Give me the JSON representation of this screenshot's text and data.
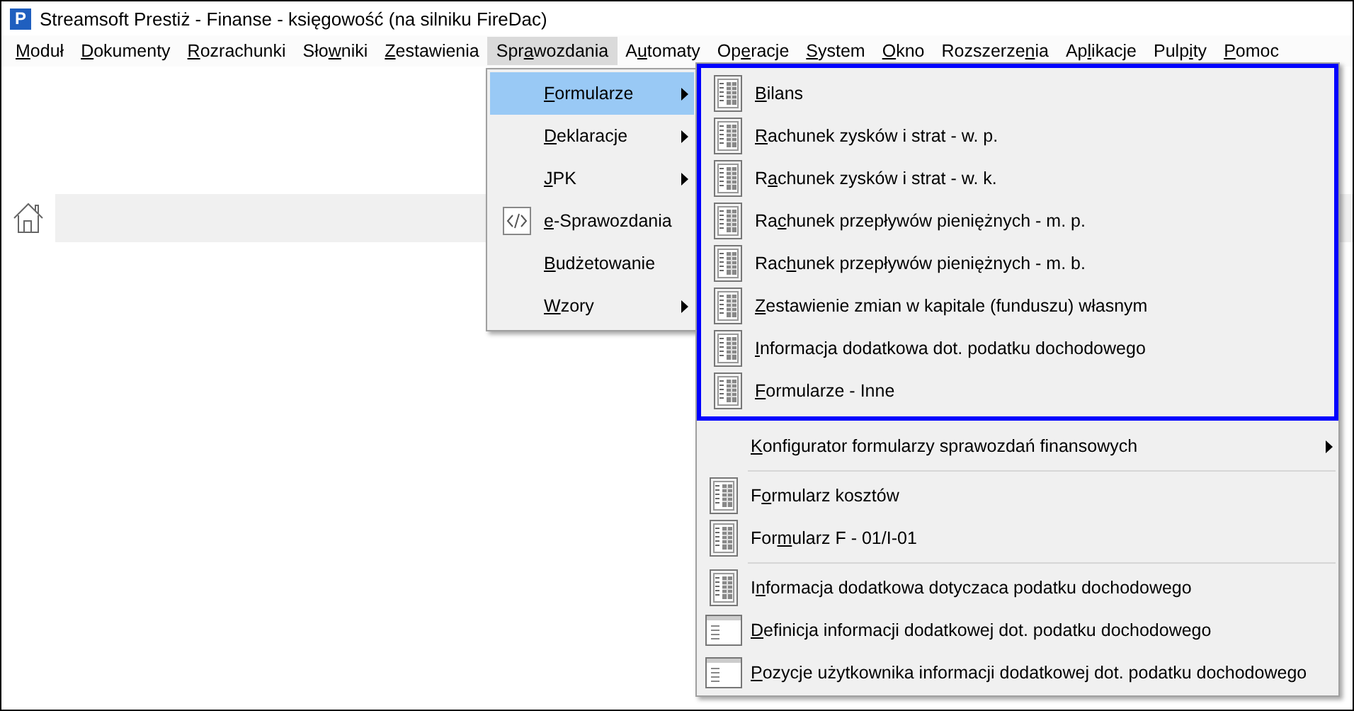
{
  "window": {
    "title": "Streamsoft Prestiż - Finanse - księgowość (na silniku FireDac)",
    "logo": "P"
  },
  "menu_bar": [
    {
      "key": "M",
      "rest": "oduł",
      "selected": false
    },
    {
      "key": "D",
      "rest": "okumenty",
      "selected": false
    },
    {
      "key": "R",
      "rest": "ozrachunki",
      "selected": false
    },
    {
      "lead": "Sło",
      "key": "w",
      "rest": "niki",
      "selected": false
    },
    {
      "key": "Z",
      "rest": "estawienia",
      "selected": false
    },
    {
      "lead": "Spr",
      "key": "a",
      "rest": "wozdania",
      "selected": true
    },
    {
      "lead": "A",
      "key": "u",
      "rest": "tomaty",
      "selected": false
    },
    {
      "lead": "Op",
      "key": "e",
      "rest": "racje",
      "selected": false
    },
    {
      "key": "S",
      "rest": "ystem",
      "selected": false
    },
    {
      "key": "O",
      "rest": "kno",
      "selected": false
    },
    {
      "lead": "Rozszerze",
      "key": "n",
      "rest": "ia",
      "selected": false
    },
    {
      "lead": "Ap",
      "key": "l",
      "rest": "ikacje",
      "selected": false
    },
    {
      "lead": "Pulp",
      "key": "i",
      "rest": "ty",
      "selected": false
    },
    {
      "key": "P",
      "rest": "omoc",
      "selected": false
    }
  ],
  "dropdown": [
    {
      "kind": "text",
      "key": "F",
      "rest": "ormularze",
      "submenu": true,
      "selected": true
    },
    {
      "kind": "text",
      "key": "D",
      "rest": "eklaracje",
      "submenu": true,
      "selected": false
    },
    {
      "kind": "text",
      "key": "J",
      "rest": "PK",
      "submenu": true,
      "selected": false
    },
    {
      "kind": "code",
      "key": "e",
      "rest": "-Sprawozdania",
      "submenu": false,
      "selected": false
    },
    {
      "kind": "text",
      "key": "B",
      "rest": "udżetowanie",
      "submenu": false,
      "selected": false
    },
    {
      "kind": "text",
      "key": "W",
      "rest": "zory",
      "submenu": true,
      "selected": false
    }
  ],
  "submenu": {
    "highlighted_items": [
      {
        "kind": "form",
        "key": "B",
        "rest": "ilans"
      },
      {
        "kind": "form",
        "key": "R",
        "rest": "achunek zysków i strat - w. p."
      },
      {
        "kind": "form",
        "lead": "R",
        "key": "a",
        "rest": "chunek zysków i strat - w. k."
      },
      {
        "kind": "form",
        "lead": "Ra",
        "key": "c",
        "rest": "hunek przepływów pieniężnych - m. p."
      },
      {
        "kind": "form",
        "lead": "Rac",
        "key": "h",
        "rest": "unek przepływów pieniężnych - m. b."
      },
      {
        "kind": "form",
        "key": "Z",
        "rest": "estawienie zmian w kapitale (funduszu) własnym"
      },
      {
        "kind": "form",
        "key": "I",
        "rest": "nformacja dodatkowa dot. podatku dochodowego"
      },
      {
        "kind": "form",
        "key": "F",
        "rest": "ormularze - Inne"
      }
    ],
    "sections": [
      [
        {
          "kind": "text",
          "key": "K",
          "rest": "onfigurator formularzy sprawozdań finansowych",
          "submenu": true
        }
      ],
      [
        {
          "kind": "form",
          "lead": "F",
          "key": "o",
          "rest": "rmularz kosztów"
        },
        {
          "kind": "form",
          "lead": "For",
          "key": "m",
          "rest": "ularz F - 01/I-01"
        }
      ],
      [
        {
          "kind": "form",
          "lead": "I",
          "key": "n",
          "rest": "formacja dodatkowa dotyczaca podatku dochodowego"
        },
        {
          "kind": "list",
          "key": "D",
          "rest": "efinicja informacji dodatkowej dot. podatku dochodowego"
        },
        {
          "kind": "list",
          "key": "P",
          "rest": "ozycje użytkownika informacji dodatkowej dot. podatku dochodowego"
        }
      ]
    ]
  }
}
